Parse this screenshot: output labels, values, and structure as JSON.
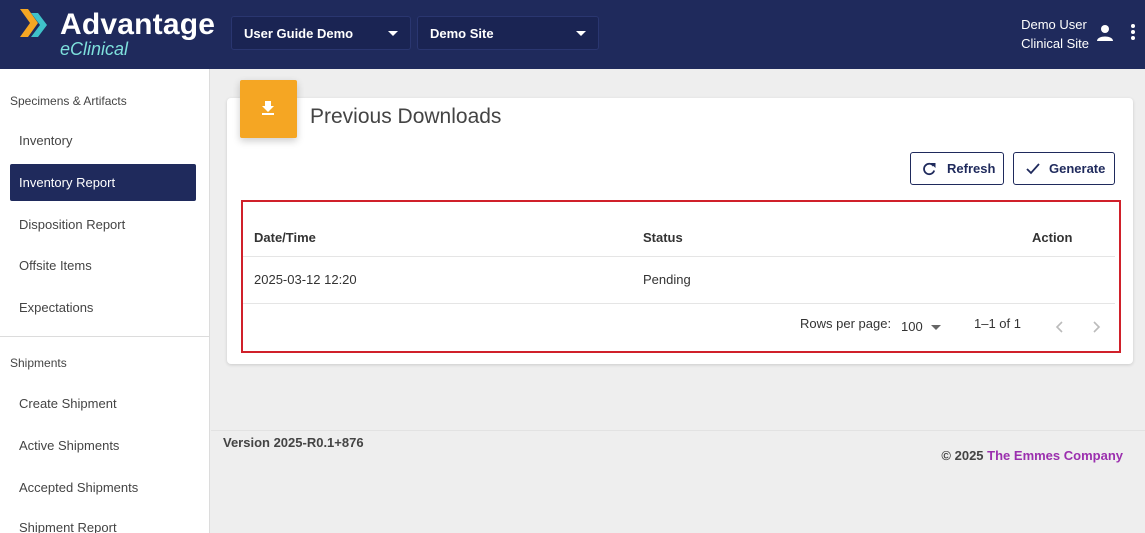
{
  "header": {
    "logo": {
      "main": "Advantage",
      "sub": "eClinical"
    },
    "study_select": "User Guide Demo",
    "site_select": "Demo Site",
    "user": {
      "name": "Demo User",
      "role": "Clinical Site"
    }
  },
  "sidebar": {
    "section1": "Specimens & Artifacts",
    "items1": [
      "Inventory",
      "Inventory Report",
      "Disposition Report",
      "Offsite Items",
      "Expectations"
    ],
    "section2": "Shipments",
    "items2": [
      "Create Shipment",
      "Active Shipments",
      "Accepted Shipments",
      "Shipment Report"
    ]
  },
  "main": {
    "title": "Previous Downloads",
    "refresh_label": "Refresh",
    "generate_label": "Generate",
    "table": {
      "headers": [
        "Date/Time",
        "Status",
        "Action"
      ],
      "rows": [
        {
          "datetime": "2025-03-12 12:20",
          "status": "Pending",
          "action": ""
        }
      ]
    },
    "pagination": {
      "rows_label": "Rows per page:",
      "rows_value": "100",
      "range": "1–1 of 1"
    }
  },
  "footer": {
    "version": "Version 2025-R0.1+876",
    "copyright": "© 2025",
    "company": "The Emmes Company"
  },
  "colors": {
    "header": "#1f2a5c",
    "accent": "#f5a623",
    "highlight": "#d0202a",
    "link": "#9b2fae"
  }
}
